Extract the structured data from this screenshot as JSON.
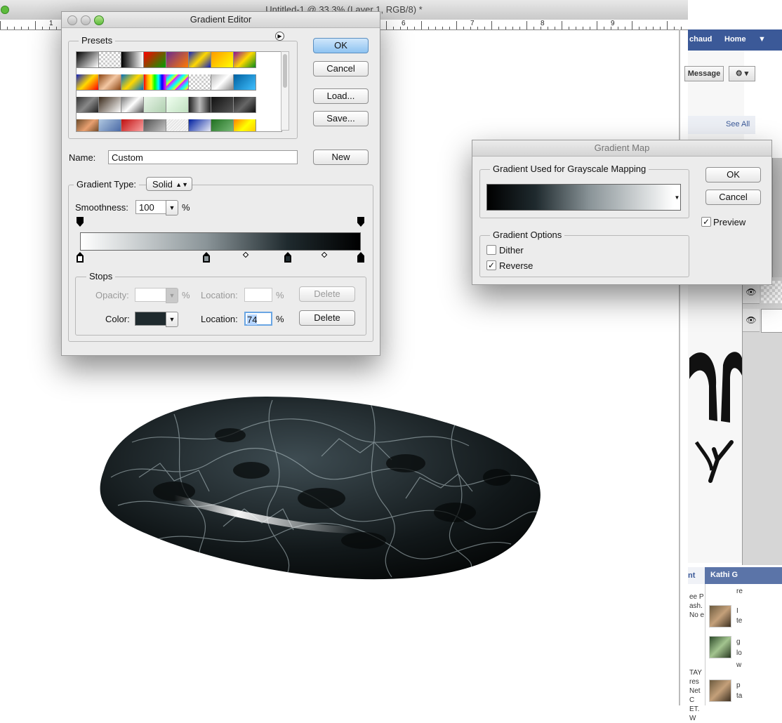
{
  "document": {
    "title": "Untitled-1 @ 33.3% (Layer 1, RGB/8) *",
    "ruler_labels": [
      "1",
      "6",
      "7",
      "8",
      "9"
    ]
  },
  "facebook": {
    "user_name": "chaud",
    "home_label": "Home",
    "message_button": "Message",
    "see_all": "See All",
    "chat_contact": "Kathi G",
    "chat_tab": "nt",
    "snippets": [
      "ee P",
      "ash.",
      "No e",
      "TAY",
      "res",
      "Net C",
      "ET. W"
    ],
    "chat_snips": [
      "re",
      "I",
      "te",
      "g",
      "lo",
      "w",
      "p",
      "ta"
    ]
  },
  "gradient_editor": {
    "title": "Gradient Editor",
    "presets_label": "Presets",
    "ok": "OK",
    "cancel": "Cancel",
    "load": "Load...",
    "save": "Save...",
    "name_label": "Name:",
    "name_value": "Custom",
    "new_button": "New",
    "gradient_type_label": "Gradient Type:",
    "gradient_type_value": "Solid",
    "smoothness_label": "Smoothness:",
    "smoothness_value": "100",
    "percent": "%",
    "stops_label": "Stops",
    "opacity_label": "Opacity:",
    "opacity_value": "",
    "location_label": "Location:",
    "location_top_value": "",
    "location_bottom_value": "74",
    "color_label": "Color:",
    "color_value": "#1f2a2e",
    "delete": "Delete",
    "color_stops": [
      {
        "location": 0,
        "color": "#ffffff",
        "selected": false
      },
      {
        "location": 45,
        "color": "#8a9498",
        "selected": false
      },
      {
        "location": 74,
        "color": "#1f2a2e",
        "selected": true
      },
      {
        "location": 100,
        "color": "#000000",
        "selected": false
      }
    ],
    "opacity_stops": [
      0,
      100
    ],
    "midpoints": [
      59,
      87
    ]
  },
  "gradient_map": {
    "title": "Gradient Map",
    "group_label": "Gradient Used for Grayscale Mapping",
    "ok": "OK",
    "cancel": "Cancel",
    "preview_label": "Preview",
    "preview_checked": true,
    "options_label": "Gradient Options",
    "dither_label": "Dither",
    "dither_checked": false,
    "reverse_label": "Reverse",
    "reverse_checked": true
  }
}
